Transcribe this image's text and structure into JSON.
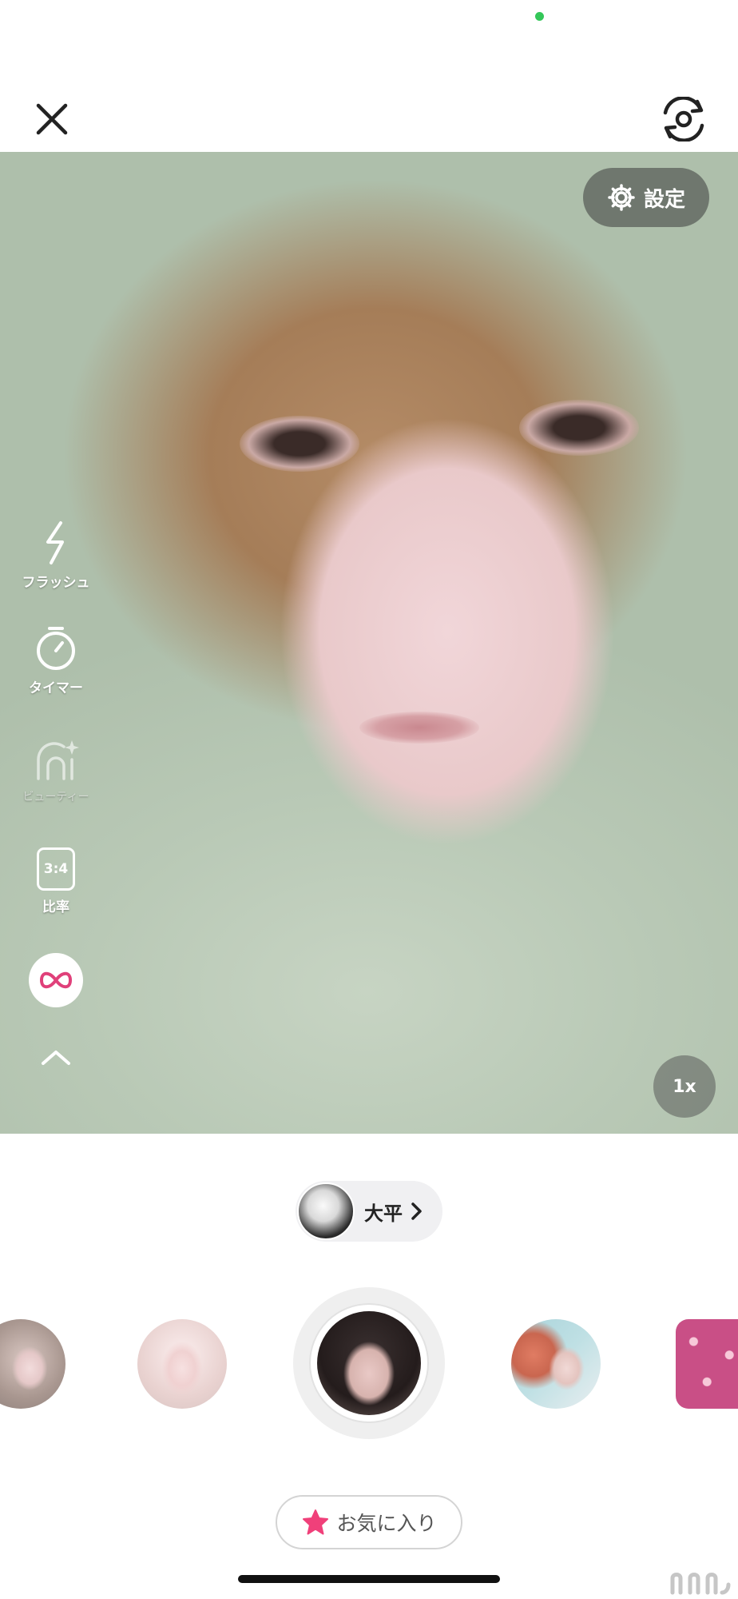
{
  "status_bar": {
    "indicator_color": "#34c759"
  },
  "top_bar": {
    "close_icon": "close-icon",
    "flip_icon": "camera-flip-icon"
  },
  "settings": {
    "label": "設定",
    "icon": "gear-icon"
  },
  "left_tools": {
    "flash": {
      "label": "フラッシュ",
      "icon": "flash-icon"
    },
    "timer": {
      "label": "タイマー",
      "icon": "timer-icon"
    },
    "beauty": {
      "label": "ビューティー",
      "icon": "beauty-face-icon"
    },
    "ratio": {
      "label": "比率",
      "value": "3:4"
    },
    "effect": {
      "icon": "bow-effect-icon",
      "color": "#e0407a"
    },
    "collapse": {
      "icon": "chevron-up-icon"
    }
  },
  "zoom": {
    "label": "1x"
  },
  "creator": {
    "name": "大平"
  },
  "filters": {
    "items": [
      "filter-1",
      "filter-2",
      "filter-selected",
      "filter-4",
      "filter-5"
    ],
    "selected_index": 2
  },
  "favorites": {
    "label": "お気に入り",
    "icon": "star-icon",
    "accent_color": "#f0407a"
  },
  "watermark": {
    "text": "n"
  }
}
